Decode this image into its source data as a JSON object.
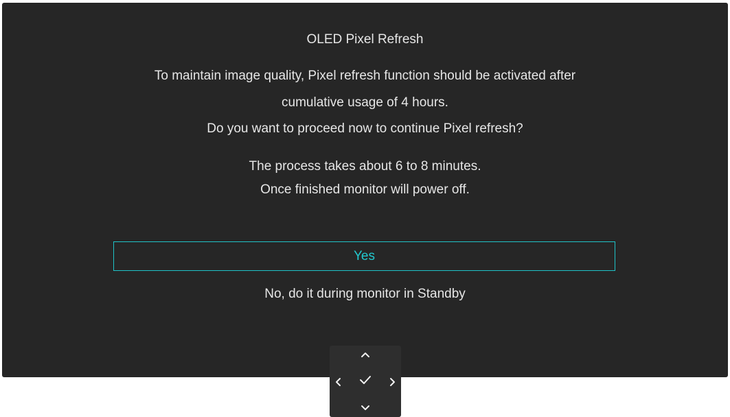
{
  "dialog": {
    "title": "OLED Pixel Refresh",
    "message_lines": [
      "To maintain image quality, Pixel refresh function should be activated after",
      "cumulative usage of 4 hours.",
      "Do you want to proceed now to continue Pixel refresh?",
      "The process takes about 6 to 8 minutes.",
      "Once finished monitor will power off."
    ],
    "options": {
      "yes_label": "Yes",
      "no_label": "No, do it during monitor in Standby",
      "selected": "Yes"
    }
  },
  "joystick": {
    "icons": [
      "chevron-up-icon",
      "chevron-left-icon",
      "checkmark-icon",
      "chevron-right-icon",
      "chevron-down-icon"
    ]
  },
  "colors": {
    "panel_background": "#262626",
    "text": "#e6e6e6",
    "accent": "#22c9cf",
    "joystick_background": "#2e2e2e"
  }
}
